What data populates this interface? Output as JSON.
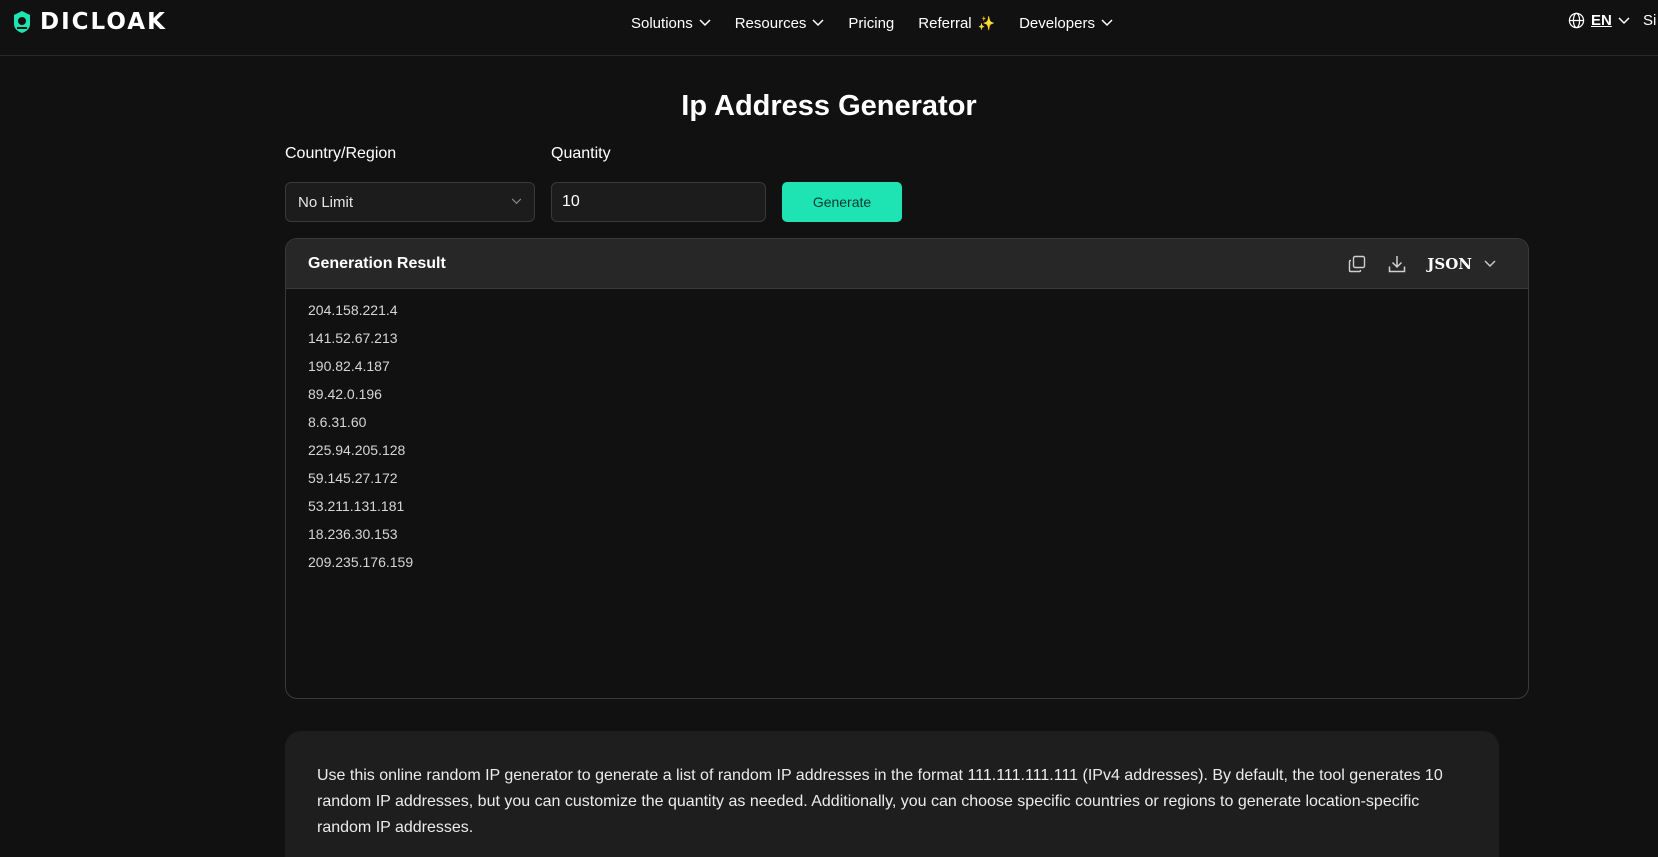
{
  "brand": {
    "name": "DICLOAK",
    "accent": "#1ee3b3"
  },
  "nav": {
    "items": [
      {
        "label": "Solutions",
        "has_dropdown": true
      },
      {
        "label": "Resources",
        "has_dropdown": true
      },
      {
        "label": "Pricing",
        "has_dropdown": false
      },
      {
        "label": "Referral",
        "has_dropdown": false,
        "badge_icon": "sparkle-icon"
      },
      {
        "label": "Developers",
        "has_dropdown": true
      }
    ],
    "language": "EN",
    "signin": "Si"
  },
  "page": {
    "title": "Ip Address Generator"
  },
  "form": {
    "country_label": "Country/Region",
    "country_value": "No Limit",
    "quantity_label": "Quantity",
    "quantity_value": "10",
    "generate_label": "Generate"
  },
  "result": {
    "title": "Generation Result",
    "format": "JSON",
    "tools": [
      "copy-icon",
      "download-icon"
    ],
    "ips": [
      "204.158.221.4",
      "141.52.67.213",
      "190.82.4.187",
      "89.42.0.196",
      "8.6.31.60",
      "225.94.205.128",
      "59.145.27.172",
      "53.211.131.181",
      "18.236.30.153",
      "209.235.176.159"
    ]
  },
  "description": {
    "text": "Use this online random IP generator to generate a list of random IP addresses in the format 111.111.111.111 (IPv4 addresses). By default, the tool generates 10 random IP addresses, but you can customize the quantity as needed. Additionally, you can choose specific countries or regions to generate location-specific random IP addresses."
  }
}
